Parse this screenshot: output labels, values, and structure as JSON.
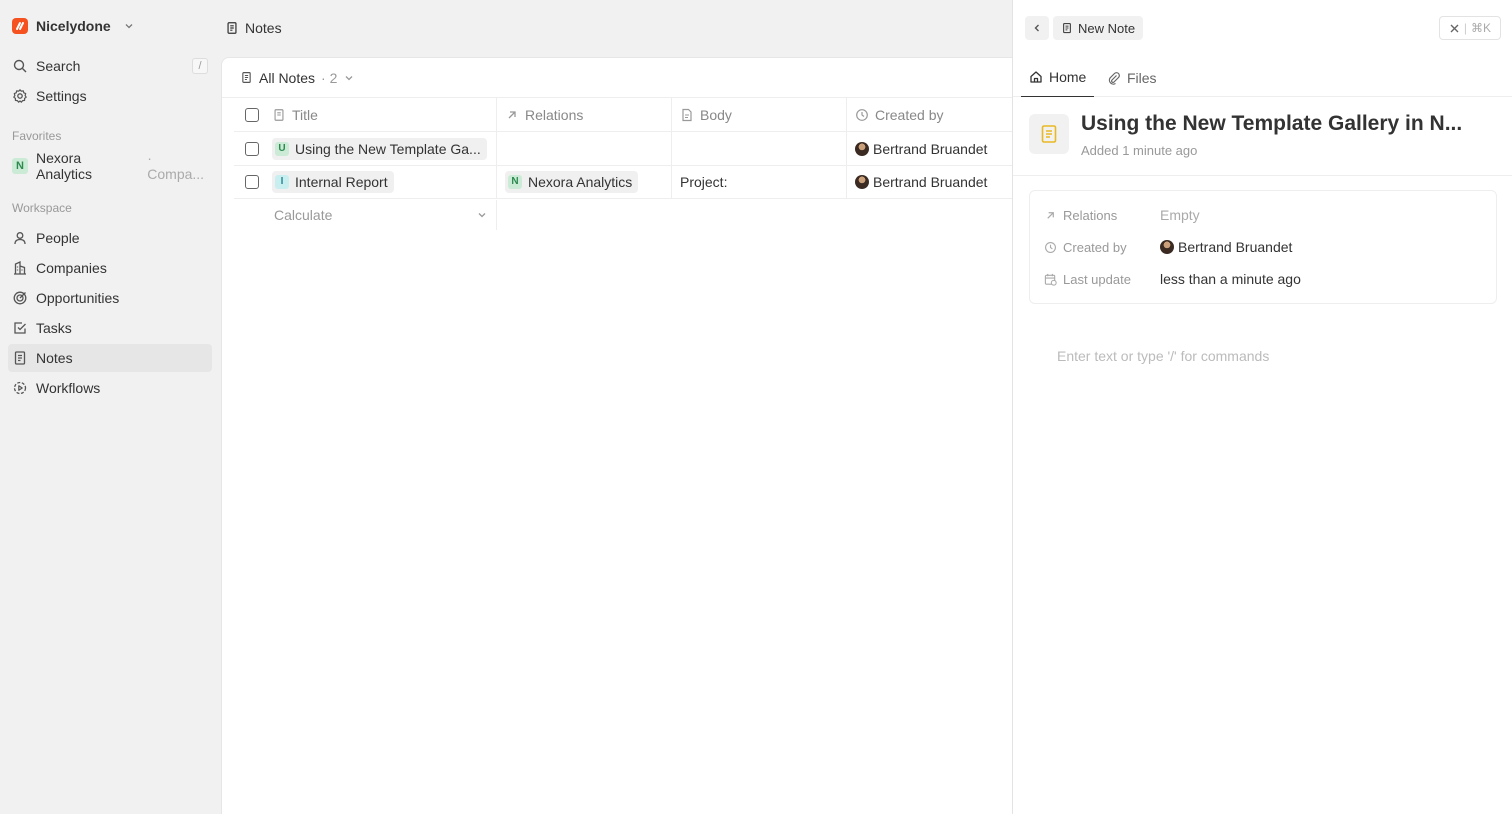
{
  "workspace": {
    "name": "Nicelydone"
  },
  "sidebar": {
    "search_label": "Search",
    "search_shortcut": "/",
    "settings_label": "Settings",
    "favorites_title": "Favorites",
    "favorite": {
      "badge": "N",
      "name": "Nexora Analytics",
      "type": "· Compa..."
    },
    "workspace_title": "Workspace",
    "items": [
      {
        "label": "People",
        "icon": "user-icon"
      },
      {
        "label": "Companies",
        "icon": "building-icon"
      },
      {
        "label": "Opportunities",
        "icon": "target-icon"
      },
      {
        "label": "Tasks",
        "icon": "checkbox-icon"
      },
      {
        "label": "Notes",
        "icon": "note-icon",
        "active": true
      },
      {
        "label": "Workflows",
        "icon": "settings-automation-icon"
      }
    ]
  },
  "topbar": {
    "title": "Notes"
  },
  "view": {
    "name": "All Notes",
    "count": "· 2"
  },
  "table": {
    "columns": [
      "Title",
      "Relations",
      "Body",
      "Created by"
    ],
    "rows": [
      {
        "badge": "U",
        "title": "Using the New Template Ga...",
        "relation": "",
        "body": "",
        "created_by": "Bertrand Bruandet"
      },
      {
        "badge": "I",
        "title": "Internal Report",
        "relation_badge": "N",
        "relation": "Nexora Analytics",
        "body": "Project:",
        "created_by": "Bertrand Bruandet"
      }
    ],
    "calculate_label": "Calculate"
  },
  "panel": {
    "crumb": "New Note",
    "close_shortcut": "⌘K",
    "tabs": [
      "Home",
      "Files"
    ],
    "title": "Using the New Template Gallery in N...",
    "subtitle": "Added 1 minute ago",
    "fields": {
      "relations_label": "Relations",
      "relations_value": "Empty",
      "created_by_label": "Created by",
      "created_by_value": "Bertrand Bruandet",
      "last_update_label": "Last update",
      "last_update_value": "less than a minute ago"
    },
    "editor_placeholder": "Enter text or type '/' for commands"
  },
  "colors": {
    "brand": "#f5521f",
    "note_icon": "#e8b923",
    "favorite_badge": "#ccebd6"
  }
}
